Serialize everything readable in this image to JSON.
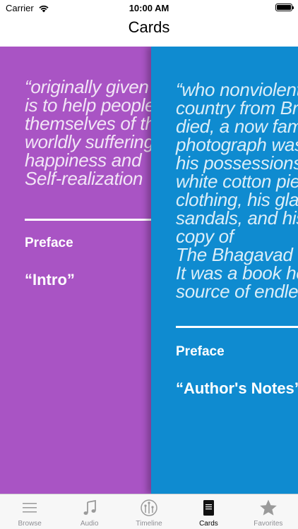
{
  "status_bar": {
    "carrier": "Carrier",
    "time": "10:00 AM"
  },
  "nav": {
    "title": "Cards"
  },
  "cards": [
    {
      "color": "#a954c4",
      "quote": "“originally given\nis to help people\nthemselves of the\nworldly suffering\nhappiness and\nSelf-realization",
      "section": "Preface",
      "title": "“Intro”"
    },
    {
      "color": "#0f8bd0",
      "quote": "“who nonviolently\ncountry from British\ndied, a now famous\nphotograph was\nhis possessions:\nwhite cotton pieces\nclothing, his glasses,\nsandals, and his\ncopy of\nThe Bhagavad Gita.\nIt was a book he\nsource of endless",
      "section": "Preface",
      "title": "“Author's Notes”"
    }
  ],
  "pager": {
    "pages": 2,
    "current": 1
  },
  "tabs": [
    {
      "label": "Browse",
      "icon": "browse-icon",
      "selected": false
    },
    {
      "label": "Audio",
      "icon": "music-note-icon",
      "selected": false
    },
    {
      "label": "Timeline",
      "icon": "timeline-icon",
      "selected": false
    },
    {
      "label": "Cards",
      "icon": "cards-icon",
      "selected": true
    },
    {
      "label": "Favorites",
      "icon": "star-icon",
      "selected": false
    }
  ]
}
